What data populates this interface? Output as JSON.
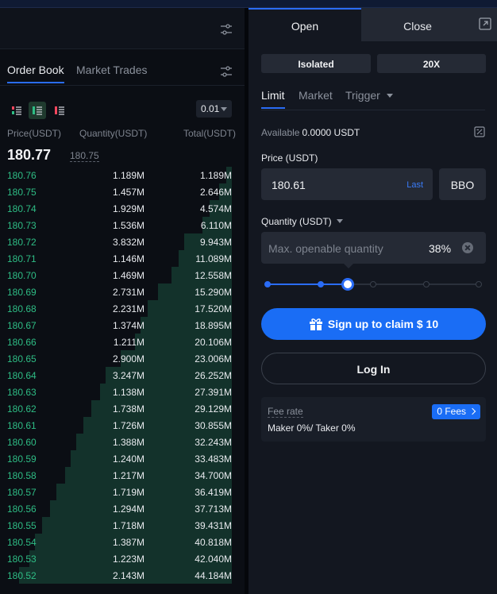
{
  "orderbook": {
    "tabs": [
      "Order Book",
      "Market Trades"
    ],
    "tick_size": "0.01",
    "columns": {
      "price": "Price(USDT)",
      "quantity": "Quantity(USDT)",
      "total": "Total(USDT)"
    },
    "last_price": "180.77",
    "mark_price": "180.75",
    "rows": [
      {
        "price": "180.76",
        "qty": "1.189M",
        "total": "1.189M"
      },
      {
        "price": "180.75",
        "qty": "1.457M",
        "total": "2.646M"
      },
      {
        "price": "180.74",
        "qty": "1.929M",
        "total": "4.574M"
      },
      {
        "price": "180.73",
        "qty": "1.536M",
        "total": "6.110M"
      },
      {
        "price": "180.72",
        "qty": "3.832M",
        "total": "9.943M"
      },
      {
        "price": "180.71",
        "qty": "1.146M",
        "total": "11.089M"
      },
      {
        "price": "180.70",
        "qty": "1.469M",
        "total": "12.558M"
      },
      {
        "price": "180.69",
        "qty": "2.731M",
        "total": "15.290M"
      },
      {
        "price": "180.68",
        "qty": "2.231M",
        "total": "17.520M"
      },
      {
        "price": "180.67",
        "qty": "1.374M",
        "total": "18.895M"
      },
      {
        "price": "180.66",
        "qty": "1.211M",
        "total": "20.106M"
      },
      {
        "price": "180.65",
        "qty": "2.900M",
        "total": "23.006M"
      },
      {
        "price": "180.64",
        "qty": "3.247M",
        "total": "26.252M"
      },
      {
        "price": "180.63",
        "qty": "1.138M",
        "total": "27.391M"
      },
      {
        "price": "180.62",
        "qty": "1.738M",
        "total": "29.129M"
      },
      {
        "price": "180.61",
        "qty": "1.726M",
        "total": "30.855M"
      },
      {
        "price": "180.60",
        "qty": "1.388M",
        "total": "32.243M"
      },
      {
        "price": "180.59",
        "qty": "1.240M",
        "total": "33.483M"
      },
      {
        "price": "180.58",
        "qty": "1.217M",
        "total": "34.700M"
      },
      {
        "price": "180.57",
        "qty": "1.719M",
        "total": "36.419M"
      },
      {
        "price": "180.56",
        "qty": "1.294M",
        "total": "37.713M"
      },
      {
        "price": "180.55",
        "qty": "1.718M",
        "total": "39.431M"
      },
      {
        "price": "180.54",
        "qty": "1.387M",
        "total": "40.818M"
      },
      {
        "price": "180.53",
        "qty": "1.223M",
        "total": "42.040M"
      },
      {
        "price": "180.52",
        "qty": "2.143M",
        "total": "44.184M"
      }
    ]
  },
  "trade": {
    "tabs": {
      "open": "Open",
      "close": "Close"
    },
    "margin_mode": "Isolated",
    "leverage": "20X",
    "order_types": {
      "limit": "Limit",
      "market": "Market",
      "trigger": "Trigger"
    },
    "available_label": "Available",
    "available_value": "0.0000 USDT",
    "price_label": "Price (USDT)",
    "price_value": "180.61",
    "last_label": "Last",
    "bbo_label": "BBO",
    "quantity_label": "Quantity (USDT)",
    "quantity_placeholder": "Max. openable quantity",
    "quantity_percent": "38%",
    "slider_percent": 38,
    "signup_label": "Sign up to claim $ 10",
    "login_label": "Log In",
    "fee_label": "Fee rate",
    "fee_value": "Maker 0%/ Taker 0%",
    "fees_badge": "0 Fees"
  },
  "colors": {
    "bid": "#2ebd85",
    "accent": "#1a6df5",
    "depth": "#13322b"
  }
}
